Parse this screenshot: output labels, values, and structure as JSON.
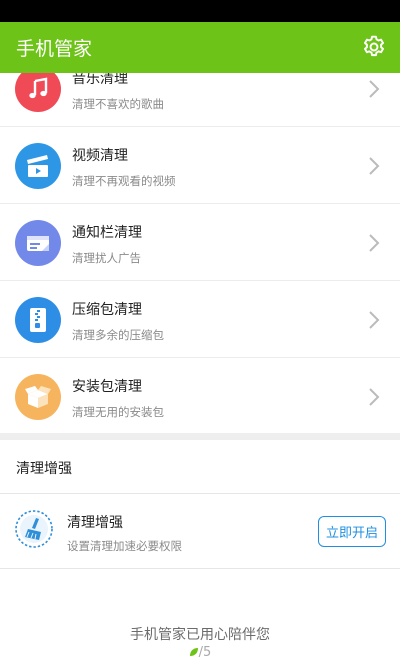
{
  "app": {
    "title": "手机管家",
    "accent_color": "#6dc318",
    "settings_icon": "gear-icon"
  },
  "clean_list": [
    {
      "id": "music",
      "title": "音乐清理",
      "subtitle": "清理不喜欢的歌曲",
      "icon": "music-note-icon",
      "icon_color": "#f04a57"
    },
    {
      "id": "video",
      "title": "视频清理",
      "subtitle": "清理不再观看的视频",
      "icon": "clapperboard-icon",
      "icon_color": "#2d97e6"
    },
    {
      "id": "notification",
      "title": "通知栏清理",
      "subtitle": "清理扰人广告",
      "icon": "notification-bar-icon",
      "icon_color": "#7389ea"
    },
    {
      "id": "archive",
      "title": "压缩包清理",
      "subtitle": "清理多余的压缩包",
      "icon": "zip-file-icon",
      "icon_color": "#2e8ee6"
    },
    {
      "id": "apk",
      "title": "安装包清理",
      "subtitle": "清理无用的安装包",
      "icon": "package-box-icon",
      "icon_color": "#f7b45f"
    }
  ],
  "enhance_section": {
    "header": "清理增强",
    "item": {
      "title": "清理增强",
      "subtitle": "设置清理加速必要权限",
      "button_label": "立即开启",
      "icon": "broom-icon",
      "button_color": "#1e8fe1"
    }
  },
  "footer": {
    "message": "手机管家已用心陪伴您",
    "page_indicator": "/5"
  }
}
